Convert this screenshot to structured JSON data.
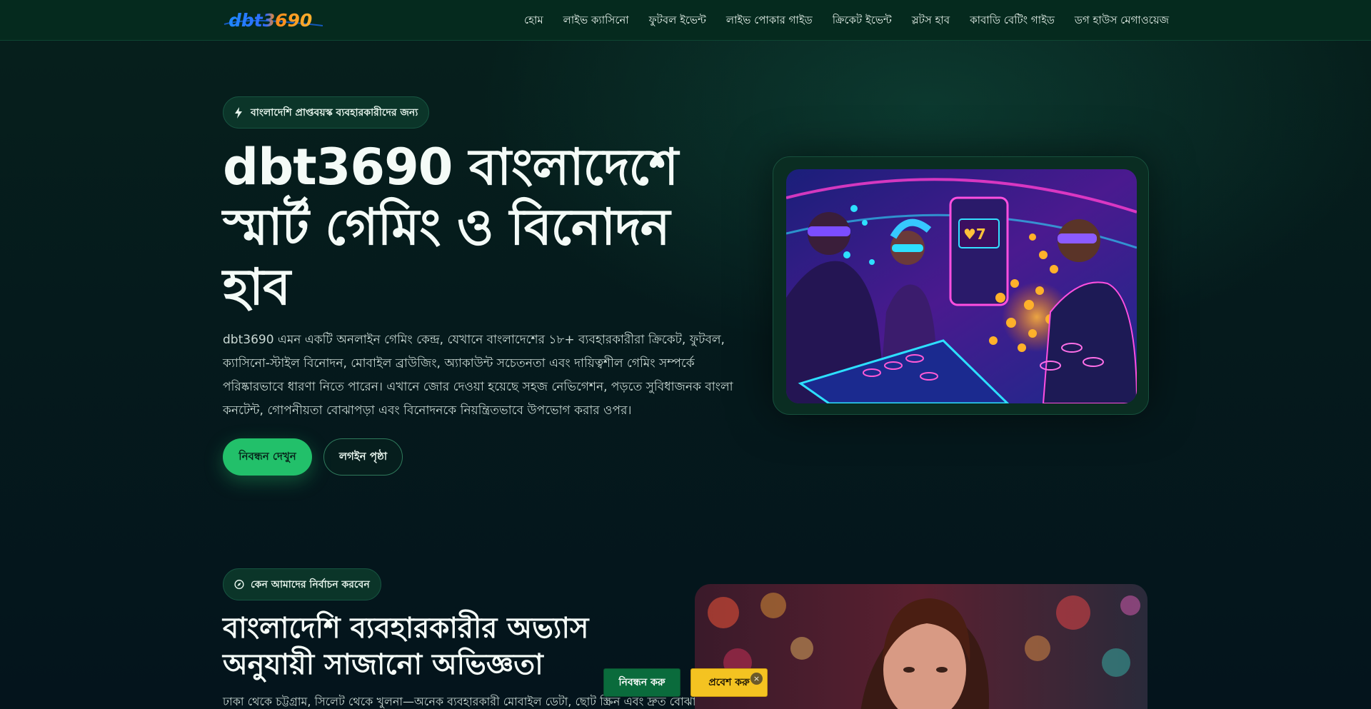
{
  "brand": {
    "logo_text": "dbt3690"
  },
  "nav": {
    "items": [
      "হোম",
      "লাইভ ক্যাসিনো",
      "ফুটবল ইভেন্ট",
      "লাইভ পোকার গাইড",
      "ক্রিকেট ইভেন্ট",
      "স্লটস হাব",
      "কাবাডি বেটিং গাইড",
      "ডগ হাউস মেগাওয়েজ"
    ]
  },
  "hero": {
    "badge": "বাংলাদেশি প্রাপ্তবয়স্ক ব্যবহারকারীদের জন্য",
    "title": "dbt3690 বাংলাদেশে স্মার্ট গেমিং ও বিনোদন হাব",
    "description": "dbt3690 এমন একটি অনলাইন গেমিং কেন্দ্র, যেখানে বাংলাদেশের ১৮+ ব্যবহারকারীরা ক্রিকেট, ফুটবল, ক্যাসিনো-স্টাইল বিনোদন, মোবাইল ব্রাউজিং, অ্যাকাউন্ট সচেতনতা এবং দায়িত্বশীল গেমিং সম্পর্কে পরিষ্কারভাবে ধারণা নিতে পারেন। এখানে জোর দেওয়া হয়েছে সহজ নেভিগেশন, পড়তে সুবিধাজনক বাংলা কনটেন্ট, গোপনীয়তা বোঝাপড়া এবং বিনোদনকে নিয়ন্ত্রিতভাবে উপভোগ করার ওপর।",
    "primary_button": "নিবন্ধন দেখুন",
    "secondary_button": "লগইন পৃষ্ঠা"
  },
  "why": {
    "badge": "কেন আমাদের নির্বাচন করবেন",
    "title": "বাংলাদেশি ব্যবহারকারীর অভ্যাস অনুযায়ী সাজানো অভিজ্ঞতা",
    "description": "ঢাকা থেকে চট্টগ্রাম, সিলেট থেকে খুলনা—অনেক ব্যবহারকারী মোবাইল ডেটা, ছোট স্ক্রিন এবং দ্রুত বোঝা যায়"
  },
  "floating": {
    "register": "নিবন্ধন করু",
    "login": "প্রবেশ করু",
    "close": "×"
  },
  "colors": {
    "accent": "#22c06a",
    "nav_bg": "#052a1e",
    "login_yellow": "#f4c321",
    "register_green": "#0a6b3c"
  }
}
